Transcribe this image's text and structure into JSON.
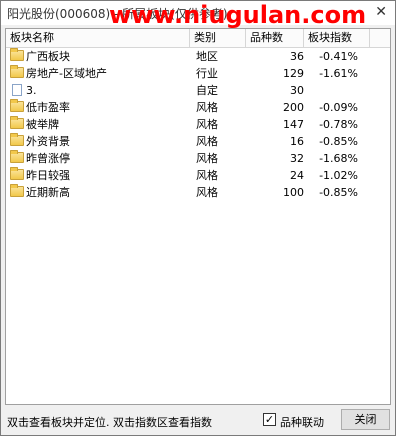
{
  "window": {
    "title": "阳光股份(000608) - 所属板块(仅供参考)",
    "watermark": "www.niugulan.com",
    "close": "✕"
  },
  "table": {
    "headers": [
      "板块名称",
      "类别",
      "品种数",
      "板块指数"
    ],
    "rows": [
      {
        "icon": "folder-icon",
        "name": "广西板块",
        "type": "地区",
        "count": "36",
        "index": "-0.41%"
      },
      {
        "icon": "folder-icon",
        "name": "房地产-区域地产",
        "type": "行业",
        "count": "129",
        "index": "-1.61%"
      },
      {
        "icon": "document-icon",
        "name": "3.",
        "type": "自定",
        "count": "30",
        "index": ""
      },
      {
        "icon": "folder-icon",
        "name": "低市盈率",
        "type": "风格",
        "count": "200",
        "index": "-0.09%"
      },
      {
        "icon": "folder-icon",
        "name": "被举牌",
        "type": "风格",
        "count": "147",
        "index": "-0.78%"
      },
      {
        "icon": "folder-icon",
        "name": "外资背景",
        "type": "风格",
        "count": "16",
        "index": "-0.85%"
      },
      {
        "icon": "folder-icon",
        "name": "昨曾涨停",
        "type": "风格",
        "count": "32",
        "index": "-1.68%"
      },
      {
        "icon": "folder-icon",
        "name": "昨日较强",
        "type": "风格",
        "count": "24",
        "index": "-1.02%"
      },
      {
        "icon": "folder-icon",
        "name": "近期新高",
        "type": "风格",
        "count": "100",
        "index": "-0.85%"
      }
    ]
  },
  "footer": {
    "hint": "双击查看板块并定位. 双击指数区查看指数",
    "checkbox_label": "品种联动",
    "checkbox_checked": true,
    "checkbox_mark": "✓",
    "close_button": "关闭"
  }
}
